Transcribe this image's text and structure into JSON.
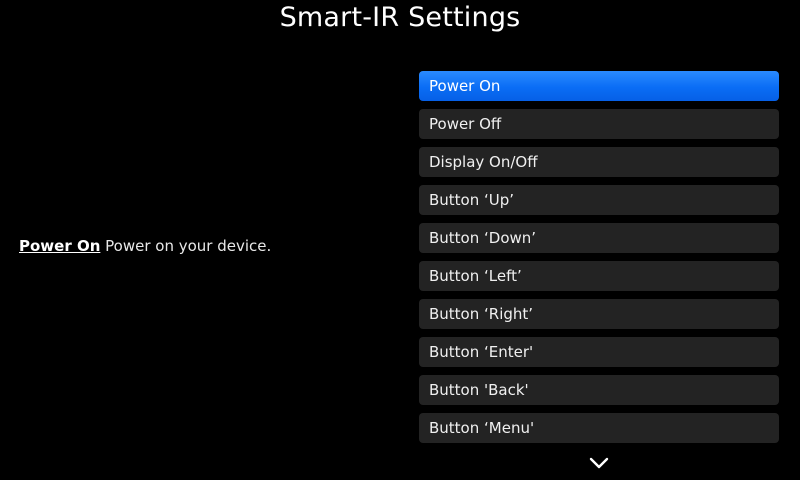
{
  "page": {
    "title": "Smart-IR Settings"
  },
  "description": {
    "name": "Power On",
    "text": " Power on your device."
  },
  "menu": {
    "selected_index": 0,
    "items": [
      {
        "label": "Power On"
      },
      {
        "label": "Power Off"
      },
      {
        "label": "Display On/Off"
      },
      {
        "label": "Button ‘Up’"
      },
      {
        "label": "Button ‘Down’"
      },
      {
        "label": "Button ‘Left’"
      },
      {
        "label": "Button ‘Right’"
      },
      {
        "label": "Button ‘Enter'"
      },
      {
        "label": "Button 'Back'"
      },
      {
        "label": "Button ‘Menu'"
      }
    ]
  },
  "icons": {
    "scroll_down": "chevron-down-icon"
  },
  "colors": {
    "background": "#000000",
    "item_background": "#232323",
    "selected_item": "#0a6df5",
    "text": "#ffffff"
  }
}
